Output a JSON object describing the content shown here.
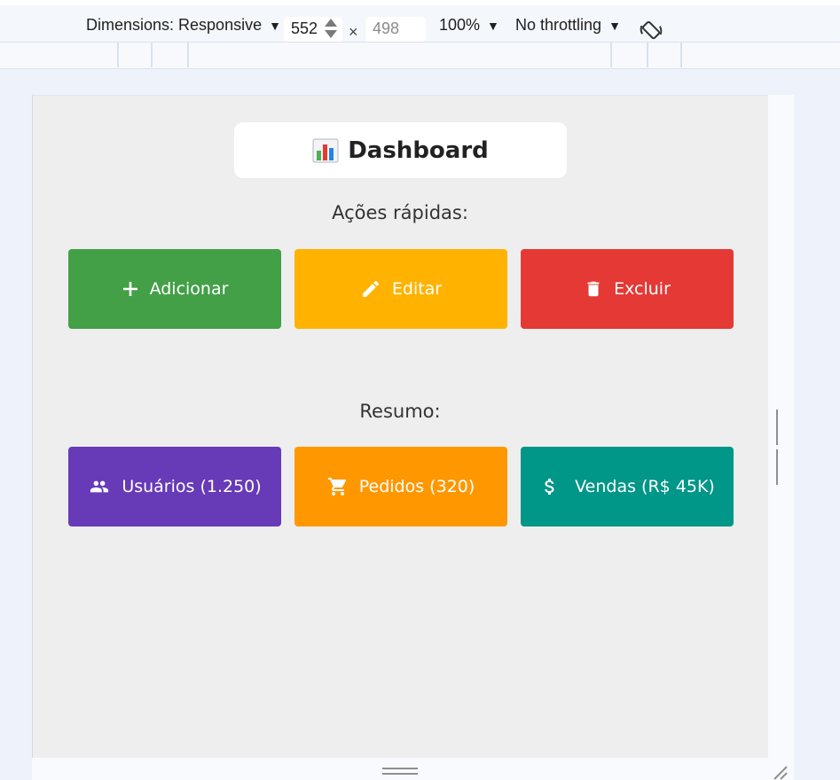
{
  "devtools": {
    "dimensions_label": "Dimensions: Responsive",
    "width_value": "552",
    "height_placeholder": "498",
    "times_sign": "×",
    "zoom_label": "100%",
    "throttling_label": "No throttling",
    "caret": "▼"
  },
  "page": {
    "title_emoji": "chart-emoji",
    "title": "Dashboard",
    "quick_actions_label": "Ações rápidas:",
    "summary_label": "Resumo:"
  },
  "quick_actions": [
    {
      "label": "Adicionar",
      "icon": "plus-icon",
      "color": "#43a047"
    },
    {
      "label": "Editar",
      "icon": "pencil-icon",
      "color": "#ffb300"
    },
    {
      "label": "Excluir",
      "icon": "trash-icon",
      "color": "#e53935"
    }
  ],
  "summary": [
    {
      "label": "Usuários (1.250)",
      "icon": "users-icon",
      "color": "#673ab7"
    },
    {
      "label": "Pedidos (320)",
      "icon": "cart-icon",
      "color": "#ff9800"
    },
    {
      "label": "Vendas (R$ 45K)",
      "icon": "dollar-icon",
      "color": "#009688"
    }
  ]
}
